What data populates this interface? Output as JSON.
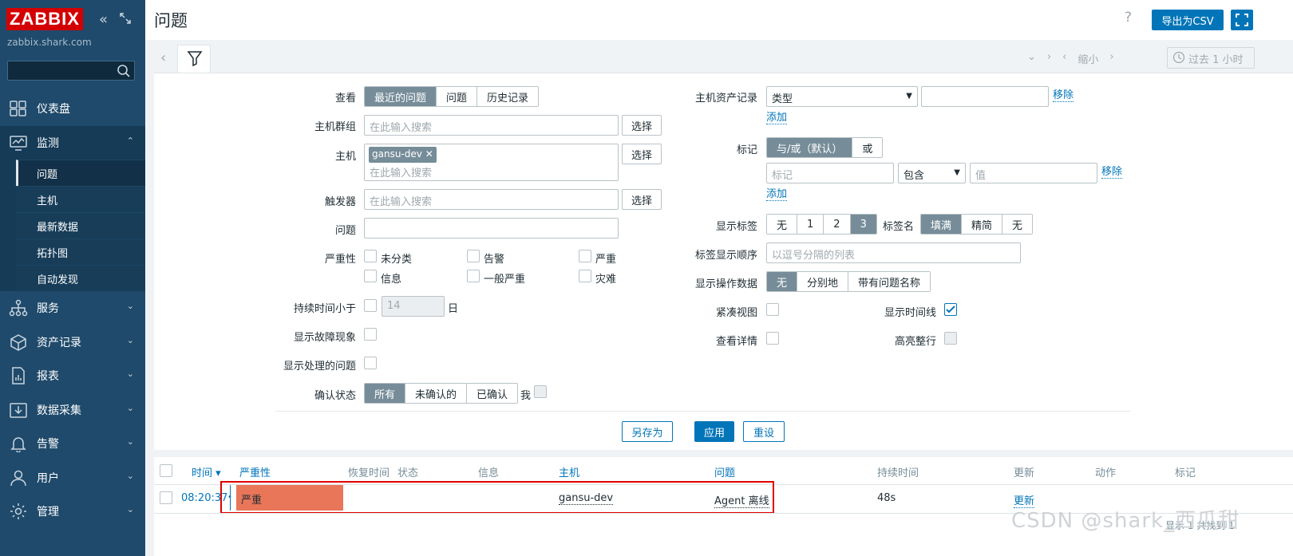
{
  "app": {
    "logo": "ZABBIX",
    "server": "zabbix.shark.com"
  },
  "sidebar": {
    "search_value": "",
    "items": [
      {
        "label": "仪表盘",
        "icon": "dashboard-icon"
      },
      {
        "label": "监测",
        "icon": "monitoring-icon"
      },
      {
        "label": "服务",
        "icon": "services-icon"
      },
      {
        "label": "资产记录",
        "icon": "inventory-icon"
      },
      {
        "label": "报表",
        "icon": "reports-icon"
      },
      {
        "label": "数据采集",
        "icon": "data-collection-icon"
      },
      {
        "label": "告警",
        "icon": "alerts-icon"
      },
      {
        "label": "用户",
        "icon": "users-icon"
      },
      {
        "label": "管理",
        "icon": "administration-icon"
      }
    ],
    "submenu": [
      "问题",
      "主机",
      "最新数据",
      "拓扑图",
      "自动发现"
    ]
  },
  "header": {
    "title": "问题",
    "help": "?",
    "export": "导出为CSV"
  },
  "timebar": {
    "zoom_out": "缩小",
    "period": "过去 1 小时"
  },
  "filter": {
    "view_label": "查看",
    "view_options": [
      "最近的问题",
      "问题",
      "历史记录"
    ],
    "hostgroup_label": "主机群组",
    "search_placeholder": "在此输入搜索",
    "select_btn": "选择",
    "host_label": "主机",
    "host_chip": "gansu-dev",
    "trigger_label": "触发器",
    "problem_label": "问题",
    "severity_label": "严重性",
    "severities": [
      "未分类",
      "告警",
      "严重",
      "信息",
      "一般严重",
      "灾难"
    ],
    "age_label": "持续时间小于",
    "age_value": "14",
    "age_unit": "日",
    "symptoms_label": "显示故障现象",
    "suppressed_label": "显示处理的问题",
    "ack_label": "确认状态",
    "ack_options": [
      "所有",
      "未确认的",
      "已确认"
    ],
    "ack_me": "我",
    "inventory_label": "主机资产记录",
    "inventory_type": "类型",
    "remove": "移除",
    "add": "添加",
    "tags_label": "标记",
    "tag_ops": [
      "与/或（默认）",
      "或"
    ],
    "tag_placeholder": "标记",
    "tag_cond": "包含",
    "value_placeholder": "值",
    "show_tags_label": "显示标签",
    "show_tags_options": [
      "无",
      "1",
      "2",
      "3"
    ],
    "tag_name_label": "标签名",
    "tag_name_options": [
      "填满",
      "精简",
      "无"
    ],
    "tag_priority_label": "标签显示顺序",
    "tag_priority_placeholder": "以逗号分隔的列表",
    "op_data_label": "显示操作数据",
    "op_data_options": [
      "无",
      "分别地",
      "带有问题名称"
    ],
    "compact_label": "紧凑视图",
    "timeline_label": "显示时间线",
    "details_label": "查看详情",
    "highlight_label": "高亮整行",
    "save_as": "另存为",
    "apply": "应用",
    "reset": "重设"
  },
  "table": {
    "headers": [
      "时间 ▾",
      "严重性",
      "恢复时间",
      "状态",
      "信息",
      "主机",
      "问题",
      "持续时间",
      "更新",
      "动作",
      "标记"
    ],
    "row": {
      "time": "08:20:37",
      "severity": "严重",
      "host": "gansu-dev",
      "problem": "Agent 离线",
      "duration": "48s",
      "update": "更新"
    },
    "footer": "显示 1 共找到 1"
  },
  "colors": {
    "sidebar": "#1f4a6b",
    "accent": "#0275b8",
    "severity_high": "#e97659"
  },
  "watermark": "CSDN @shark_西瓜甜"
}
